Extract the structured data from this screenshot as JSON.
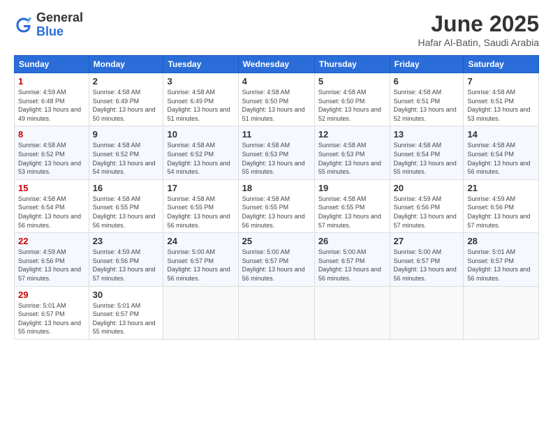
{
  "header": {
    "logo_general": "General",
    "logo_blue": "Blue",
    "month_title": "June 2025",
    "location": "Hafar Al-Batin, Saudi Arabia"
  },
  "weekdays": [
    "Sunday",
    "Monday",
    "Tuesday",
    "Wednesday",
    "Thursday",
    "Friday",
    "Saturday"
  ],
  "weeks": [
    [
      {
        "day": "1",
        "sunrise": "4:59 AM",
        "sunset": "6:48 PM",
        "daylight": "13 hours and 49 minutes."
      },
      {
        "day": "2",
        "sunrise": "4:58 AM",
        "sunset": "6:49 PM",
        "daylight": "13 hours and 50 minutes."
      },
      {
        "day": "3",
        "sunrise": "4:58 AM",
        "sunset": "6:49 PM",
        "daylight": "13 hours and 51 minutes."
      },
      {
        "day": "4",
        "sunrise": "4:58 AM",
        "sunset": "6:50 PM",
        "daylight": "13 hours and 51 minutes."
      },
      {
        "day": "5",
        "sunrise": "4:58 AM",
        "sunset": "6:50 PM",
        "daylight": "13 hours and 52 minutes."
      },
      {
        "day": "6",
        "sunrise": "4:58 AM",
        "sunset": "6:51 PM",
        "daylight": "13 hours and 52 minutes."
      },
      {
        "day": "7",
        "sunrise": "4:58 AM",
        "sunset": "6:51 PM",
        "daylight": "13 hours and 53 minutes."
      }
    ],
    [
      {
        "day": "8",
        "sunrise": "4:58 AM",
        "sunset": "6:52 PM",
        "daylight": "13 hours and 53 minutes."
      },
      {
        "day": "9",
        "sunrise": "4:58 AM",
        "sunset": "6:52 PM",
        "daylight": "13 hours and 54 minutes."
      },
      {
        "day": "10",
        "sunrise": "4:58 AM",
        "sunset": "6:52 PM",
        "daylight": "13 hours and 54 minutes."
      },
      {
        "day": "11",
        "sunrise": "4:58 AM",
        "sunset": "6:53 PM",
        "daylight": "13 hours and 55 minutes."
      },
      {
        "day": "12",
        "sunrise": "4:58 AM",
        "sunset": "6:53 PM",
        "daylight": "13 hours and 55 minutes."
      },
      {
        "day": "13",
        "sunrise": "4:58 AM",
        "sunset": "6:54 PM",
        "daylight": "13 hours and 55 minutes."
      },
      {
        "day": "14",
        "sunrise": "4:58 AM",
        "sunset": "6:54 PM",
        "daylight": "13 hours and 56 minutes."
      }
    ],
    [
      {
        "day": "15",
        "sunrise": "4:58 AM",
        "sunset": "6:54 PM",
        "daylight": "13 hours and 56 minutes."
      },
      {
        "day": "16",
        "sunrise": "4:58 AM",
        "sunset": "6:55 PM",
        "daylight": "13 hours and 56 minutes."
      },
      {
        "day": "17",
        "sunrise": "4:58 AM",
        "sunset": "6:55 PM",
        "daylight": "13 hours and 56 minutes."
      },
      {
        "day": "18",
        "sunrise": "4:58 AM",
        "sunset": "6:55 PM",
        "daylight": "13 hours and 56 minutes."
      },
      {
        "day": "19",
        "sunrise": "4:58 AM",
        "sunset": "6:55 PM",
        "daylight": "13 hours and 57 minutes."
      },
      {
        "day": "20",
        "sunrise": "4:59 AM",
        "sunset": "6:56 PM",
        "daylight": "13 hours and 57 minutes."
      },
      {
        "day": "21",
        "sunrise": "4:59 AM",
        "sunset": "6:56 PM",
        "daylight": "13 hours and 57 minutes."
      }
    ],
    [
      {
        "day": "22",
        "sunrise": "4:59 AM",
        "sunset": "6:56 PM",
        "daylight": "13 hours and 57 minutes."
      },
      {
        "day": "23",
        "sunrise": "4:59 AM",
        "sunset": "6:56 PM",
        "daylight": "13 hours and 57 minutes."
      },
      {
        "day": "24",
        "sunrise": "5:00 AM",
        "sunset": "6:57 PM",
        "daylight": "13 hours and 56 minutes."
      },
      {
        "day": "25",
        "sunrise": "5:00 AM",
        "sunset": "6:57 PM",
        "daylight": "13 hours and 56 minutes."
      },
      {
        "day": "26",
        "sunrise": "5:00 AM",
        "sunset": "6:57 PM",
        "daylight": "13 hours and 56 minutes."
      },
      {
        "day": "27",
        "sunrise": "5:00 AM",
        "sunset": "6:57 PM",
        "daylight": "13 hours and 56 minutes."
      },
      {
        "day": "28",
        "sunrise": "5:01 AM",
        "sunset": "6:57 PM",
        "daylight": "13 hours and 56 minutes."
      }
    ],
    [
      {
        "day": "29",
        "sunrise": "5:01 AM",
        "sunset": "6:57 PM",
        "daylight": "13 hours and 55 minutes."
      },
      {
        "day": "30",
        "sunrise": "5:01 AM",
        "sunset": "6:57 PM",
        "daylight": "13 hours and 55 minutes."
      },
      null,
      null,
      null,
      null,
      null
    ]
  ]
}
